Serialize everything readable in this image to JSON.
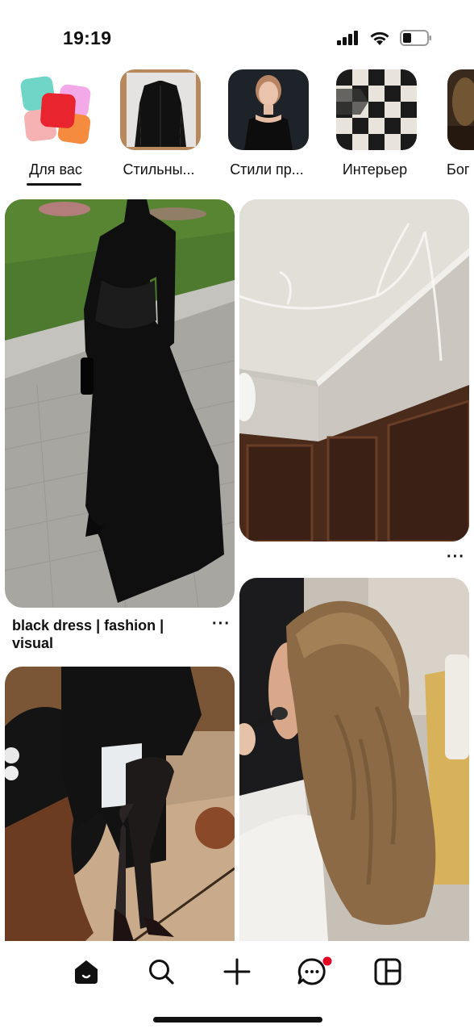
{
  "status_bar": {
    "time": "19:19"
  },
  "boards": [
    {
      "label": "Для вас",
      "selected": true,
      "icon": "for-you-tiles-icon"
    },
    {
      "label": "Стильны..."
    },
    {
      "label": "Стили пр..."
    },
    {
      "label": "Интерьер"
    },
    {
      "label": "Бог"
    }
  ],
  "pins": [
    {
      "title": "black dress | fashion | visual",
      "more_label": "···"
    },
    {
      "more_label": "···"
    }
  ],
  "nav": {
    "items": [
      "home-icon",
      "search-icon",
      "create-plus-icon",
      "messages-icon",
      "boards-icon"
    ],
    "notification_color": "#e60023"
  }
}
